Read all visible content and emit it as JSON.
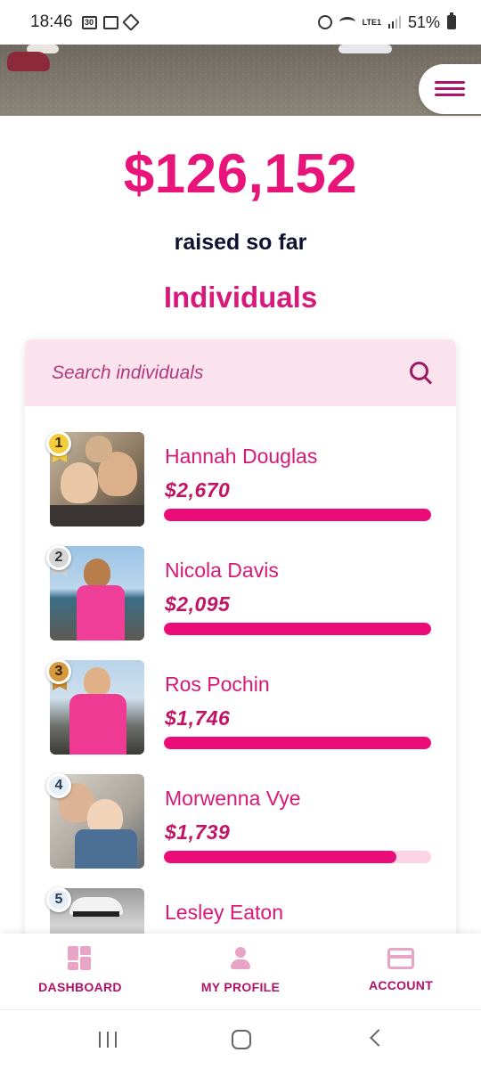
{
  "status_bar": {
    "time": "18:46",
    "battery": "51%",
    "network": "LTE1",
    "icons": [
      "calendar-icon",
      "app-icon",
      "sync-icon",
      "alarm-icon",
      "wifi-icon",
      "signal-icon",
      "battery-icon"
    ]
  },
  "header": {
    "menu_icon": "hamburger-icon"
  },
  "summary": {
    "amount": "$126,152",
    "raised_label": "raised so far",
    "section_title": "Individuals"
  },
  "search": {
    "placeholder": "Search individuals",
    "icon": "search-icon"
  },
  "individuals": [
    {
      "rank": "1",
      "name": "Hannah Douglas",
      "amount": "$2,670",
      "progress": 1.0,
      "badge_color": "#f5cd3b"
    },
    {
      "rank": "2",
      "name": "Nicola Davis",
      "amount": "$2,095",
      "progress": 1.0,
      "badge_color": "#d6d6d6"
    },
    {
      "rank": "3",
      "name": "Ros Pochin",
      "amount": "$1,746",
      "progress": 1.0,
      "badge_color": "#d59a3e"
    },
    {
      "rank": "4",
      "name": "Morwenna Vye",
      "amount": "$1,739",
      "progress": 0.87,
      "badge_color": "#e6eef7"
    },
    {
      "rank": "5",
      "name": "Lesley Eaton",
      "amount": "",
      "progress": 0,
      "badge_color": "#e6eef7"
    }
  ],
  "bottom_nav": {
    "items": [
      {
        "label": "DASHBOARD",
        "icon": "dashboard-icon"
      },
      {
        "label": "MY PROFILE",
        "icon": "profile-icon"
      },
      {
        "label": "ACCOUNT",
        "icon": "credit-card-icon"
      }
    ]
  },
  "colors": {
    "accent": "#e8147a",
    "accent_dark": "#b0126a",
    "search_bg": "#fbe3ee",
    "bar_track": "#fbd5e6",
    "navy": "#0e1230"
  }
}
